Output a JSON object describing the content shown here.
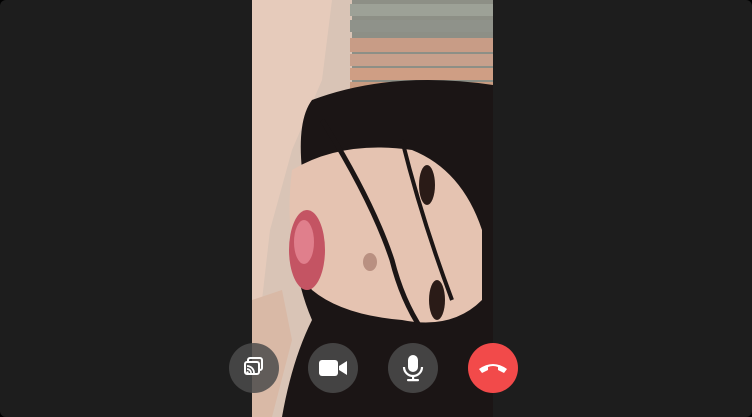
{
  "call": {
    "state": "in-call",
    "remote_video": "remote-participant-video"
  },
  "controls": [
    {
      "name": "screen-share-button",
      "icon": "screen-share-icon"
    },
    {
      "name": "camera-toggle-button",
      "icon": "video-camera-icon"
    },
    {
      "name": "microphone-toggle-button",
      "icon": "microphone-icon"
    },
    {
      "name": "end-call-button",
      "icon": "hang-up-phone-icon"
    }
  ],
  "colors": {
    "window_background": "#1d1d1d",
    "control_button": "#4b4b4b",
    "end_call": "#f24a4a",
    "icon": "#ffffff"
  }
}
